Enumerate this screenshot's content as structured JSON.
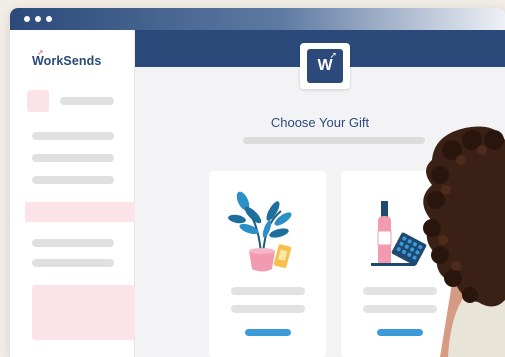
{
  "brand": {
    "name": "WorkSends",
    "badge_letter": "W",
    "primary_color": "#2b4a7a",
    "accent_pink": "#fbe3e7",
    "button_blue": "#3b9bd8"
  },
  "window": {
    "controls": [
      "dot",
      "dot",
      "dot"
    ]
  },
  "main": {
    "heading": "Choose Your Gift"
  },
  "gifts": [
    {
      "icon": "potted-plant-gift-icon"
    },
    {
      "icon": "wine-and-chocolate-gift-icon"
    }
  ],
  "person": {
    "icon": "curly-haired-woman-photo"
  }
}
